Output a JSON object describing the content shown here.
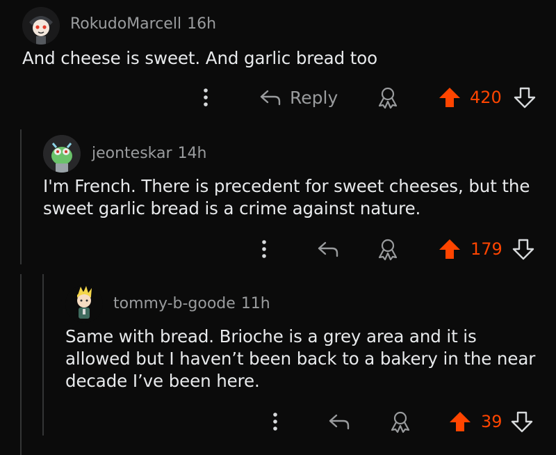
{
  "comments": [
    {
      "username": "RokudoMarcell",
      "age": "16h",
      "text": "And cheese is sweet. And garlic bread too",
      "reply_label": "Reply",
      "score": "420",
      "vote_state": "upvoted"
    },
    {
      "username": "jeonteskar",
      "age": "14h",
      "text": "I'm French. There is precedent for sweet cheeses, but the sweet garlic bread is a crime against nature.",
      "score": "179",
      "vote_state": "upvoted"
    },
    {
      "username": "tommy-b-goode",
      "age": "11h",
      "text": "Same with bread. Brioche is a grey area and it is allowed but I haven’t been back to a bakery in the near decade I’ve been here.",
      "score": "39",
      "vote_state": "upvoted"
    }
  ],
  "colors": {
    "background": "#0b0b0b",
    "text": "#e8eaec",
    "meta": "#9a9c9e",
    "upvote": "#ff4500",
    "thread_line": "#343536"
  },
  "icons": {
    "more": "vertical-dots-icon",
    "reply": "reply-arrow-icon",
    "award": "award-icon",
    "upvote": "upvote-arrow-icon",
    "downvote": "downvote-arrow-icon"
  }
}
